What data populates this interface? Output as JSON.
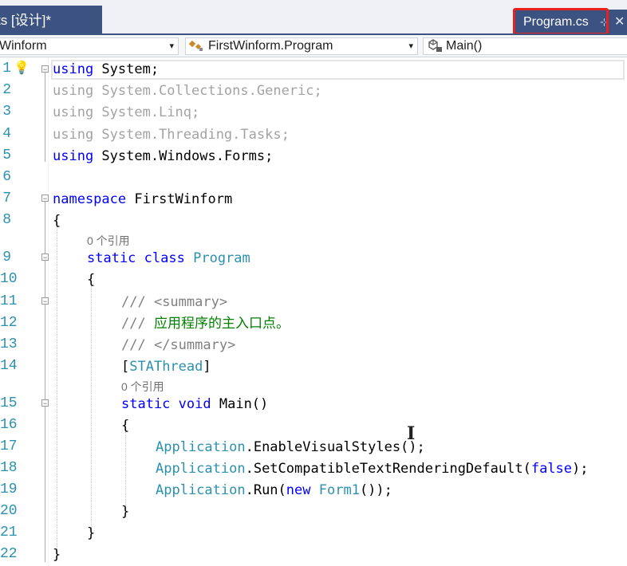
{
  "tabs": {
    "designer_tab": "ts [设计]*",
    "active_tab": "Program.cs",
    "pin_glyph": "⊹",
    "close_glyph": "✕"
  },
  "navigation": {
    "project": "Winform",
    "class": "FirstWinform.Program",
    "member": "Main()",
    "dropdown_glyph": "▾"
  },
  "editor": {
    "line_numbers": [
      "1",
      "2",
      "3",
      "4",
      "5",
      "6",
      "7",
      "8",
      "",
      "9",
      "10",
      "11",
      "12",
      "13",
      "14",
      "",
      "15",
      "16",
      "17",
      "18",
      "19",
      "20",
      "21",
      "22"
    ],
    "reference_hint": "0 个引用",
    "lines": {
      "l1": [
        "using",
        " System;"
      ],
      "l2": "using System.Collections.Generic;",
      "l3": "using System.Linq;",
      "l4": "using System.Threading.Tasks;",
      "l5": [
        "using",
        " System.Windows.Forms;"
      ],
      "l7": [
        "namespace",
        " FirstWinform"
      ],
      "l8": "{",
      "l9": [
        "static",
        " ",
        "class",
        " ",
        "Program"
      ],
      "l10": "{",
      "l11": [
        "///",
        " <summary>"
      ],
      "l12": [
        "///",
        " 应用程序的主入口点。"
      ],
      "l13": [
        "///",
        " </summary>"
      ],
      "l14": [
        "[",
        "STAThread",
        "]"
      ],
      "l15": [
        "static",
        " ",
        "void",
        " Main()"
      ],
      "l16": "{",
      "l17": [
        "Application",
        ".EnableVisualStyles();"
      ],
      "l18": [
        "Application",
        ".SetCompatibleTextRenderingDefault(",
        "false",
        ");"
      ],
      "l19": [
        "Application",
        ".Run(",
        "new",
        " ",
        "Form1",
        "());"
      ],
      "l20": "}",
      "l21": "}",
      "l22": "}"
    }
  },
  "colors": {
    "tab_bar": "#3c5280",
    "highlight": "#e8201e",
    "keyword": "#0000ff",
    "type": "#2b91af",
    "comment": "#008000",
    "line_number": "#2b91af"
  }
}
